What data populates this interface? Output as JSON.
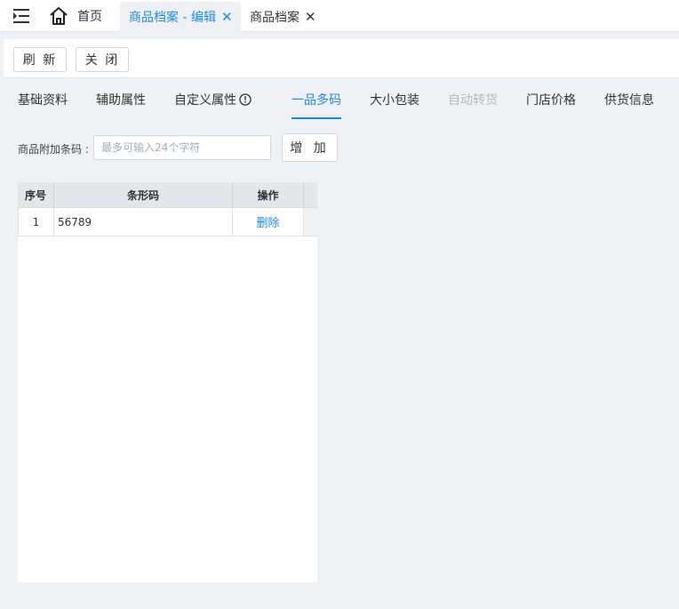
{
  "topbar": {
    "home_label": "首页",
    "tabs": [
      {
        "label": "商品档案 - 编辑",
        "active": true
      },
      {
        "label": "商品档案",
        "active": false
      }
    ],
    "close_glyph": "✕"
  },
  "toolbar": {
    "refresh_label": "刷 新",
    "close_label": "关 闭"
  },
  "subtabs": [
    {
      "label": "基础资料",
      "state": "normal"
    },
    {
      "label": "辅助属性",
      "state": "normal"
    },
    {
      "label": "自定义属性",
      "state": "normal",
      "icon": "info-icon"
    },
    {
      "label": "一品多码",
      "state": "active"
    },
    {
      "label": "大小包装",
      "state": "normal"
    },
    {
      "label": "自动转货",
      "state": "disabled"
    },
    {
      "label": "门店价格",
      "state": "normal"
    },
    {
      "label": "供货信息",
      "state": "normal"
    }
  ],
  "form": {
    "label": "商品附加条码 :",
    "placeholder": "最多可输入24个字符",
    "value": "",
    "add_label": "增 加"
  },
  "grid": {
    "columns": [
      "序号",
      "条形码",
      "操作"
    ],
    "rows": [
      {
        "seq": "1",
        "barcode": "56789",
        "action": "删除"
      }
    ]
  },
  "colors": {
    "accent": "#1b8bef",
    "disabled": "#b5b8be",
    "background": "#f0f1f4"
  }
}
